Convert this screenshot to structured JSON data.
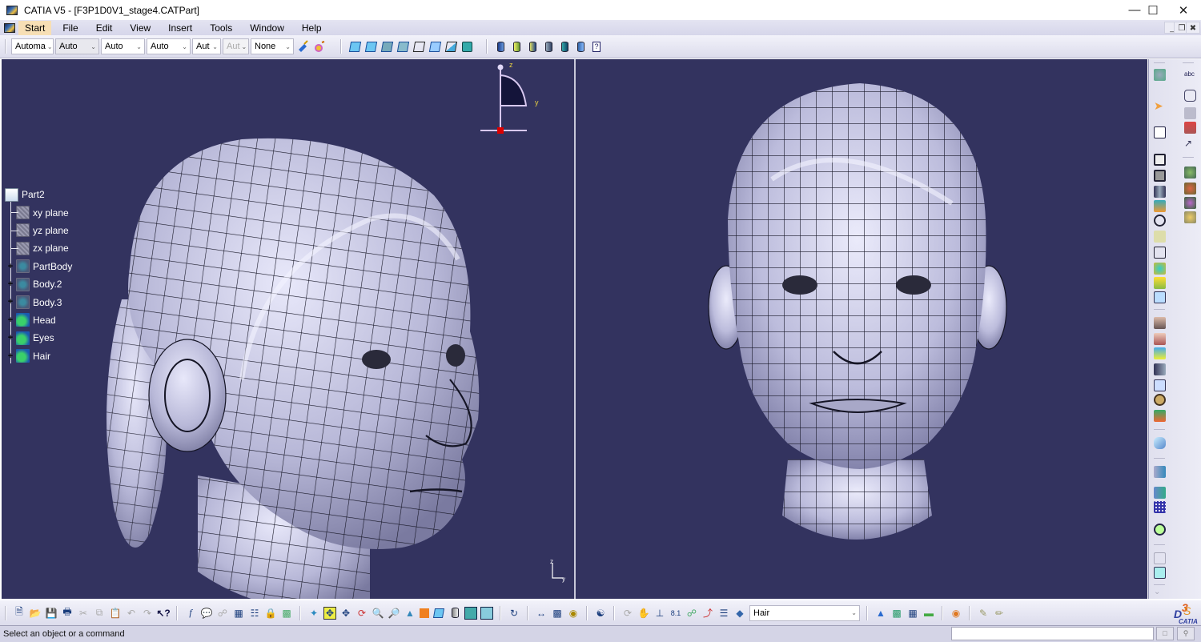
{
  "window": {
    "title": "CATIA V5 - [F3P1D0V1_stage4.CATPart]",
    "controls": [
      "minimize",
      "maximize",
      "close"
    ],
    "mdi_controls": [
      "minimize",
      "restore",
      "close"
    ]
  },
  "menubar": {
    "items": [
      {
        "label": "Start",
        "active": true
      },
      {
        "label": "File"
      },
      {
        "label": "Edit"
      },
      {
        "label": "View"
      },
      {
        "label": "Insert"
      },
      {
        "label": "Tools"
      },
      {
        "label": "Window"
      },
      {
        "label": "Help"
      }
    ]
  },
  "graphic_properties_toolbar": {
    "combos": [
      {
        "name": "color-combo",
        "value": "Automa"
      },
      {
        "name": "transparency-combo",
        "value": "Auto"
      },
      {
        "name": "linetype-combo",
        "value": "Auto"
      },
      {
        "name": "linethickness-combo",
        "value": "Auto"
      },
      {
        "name": "point-symbol-combo",
        "value": "Aut"
      },
      {
        "name": "rendering-style-combo",
        "value": "Aut",
        "disabled": true
      },
      {
        "name": "layer-combo",
        "value": "None"
      }
    ],
    "buttons": [
      "painter-icon",
      "properties-icon"
    ]
  },
  "view_toolbar": {
    "render_modes": [
      "shading",
      "shading-with-edges",
      "shading-edges-no-smooth",
      "shading-edges-hidden",
      "shading-with-material",
      "wireframe",
      "customize-view",
      "view-mode-dialog"
    ],
    "analysis_tools": [
      "draft-analysis",
      "curvature-analysis",
      "surfacic-analysis",
      "porcupine",
      "connect-checker",
      "distance-analysis",
      "help-tool"
    ]
  },
  "tree": {
    "root": "Part2",
    "nodes": [
      {
        "label": "xy plane",
        "icon": "plane-icon",
        "expandable": false
      },
      {
        "label": "yz plane",
        "icon": "plane-icon",
        "expandable": false
      },
      {
        "label": "zx plane",
        "icon": "plane-icon",
        "expandable": false
      },
      {
        "label": "PartBody",
        "icon": "body-icon",
        "expandable": true
      },
      {
        "label": "Body.2",
        "icon": "body-icon",
        "expandable": true
      },
      {
        "label": "Body.3",
        "icon": "body-icon",
        "expandable": true
      },
      {
        "label": "Head",
        "icon": "geometrical-set-icon",
        "expandable": true
      },
      {
        "label": "Eyes",
        "icon": "geometrical-set-icon",
        "expandable": true
      },
      {
        "label": "Hair",
        "icon": "geometrical-set-icon",
        "expandable": true
      }
    ]
  },
  "compass": {
    "axes": [
      "z",
      "y"
    ]
  },
  "axis_triad": {
    "axes": [
      "z",
      "y"
    ]
  },
  "viewports": [
    {
      "name": "perspective-view",
      "content": "3D head model, three-quarter view, shaded with edges"
    },
    {
      "name": "front-view",
      "content": "3D head model, front view, shaded with edges"
    }
  ],
  "bottom_toolbar": {
    "current_set": "Hair",
    "current_set_options": [
      "Hair"
    ]
  },
  "status": {
    "message": "Select an object or a command",
    "command_input": ""
  },
  "colors": {
    "viewport_bg": "#33335f",
    "surface": "#c8c8e8",
    "chrome": "#e0e0ee",
    "menu_active": "#f7dfb5"
  },
  "logo": {
    "brand": "CATIA"
  }
}
